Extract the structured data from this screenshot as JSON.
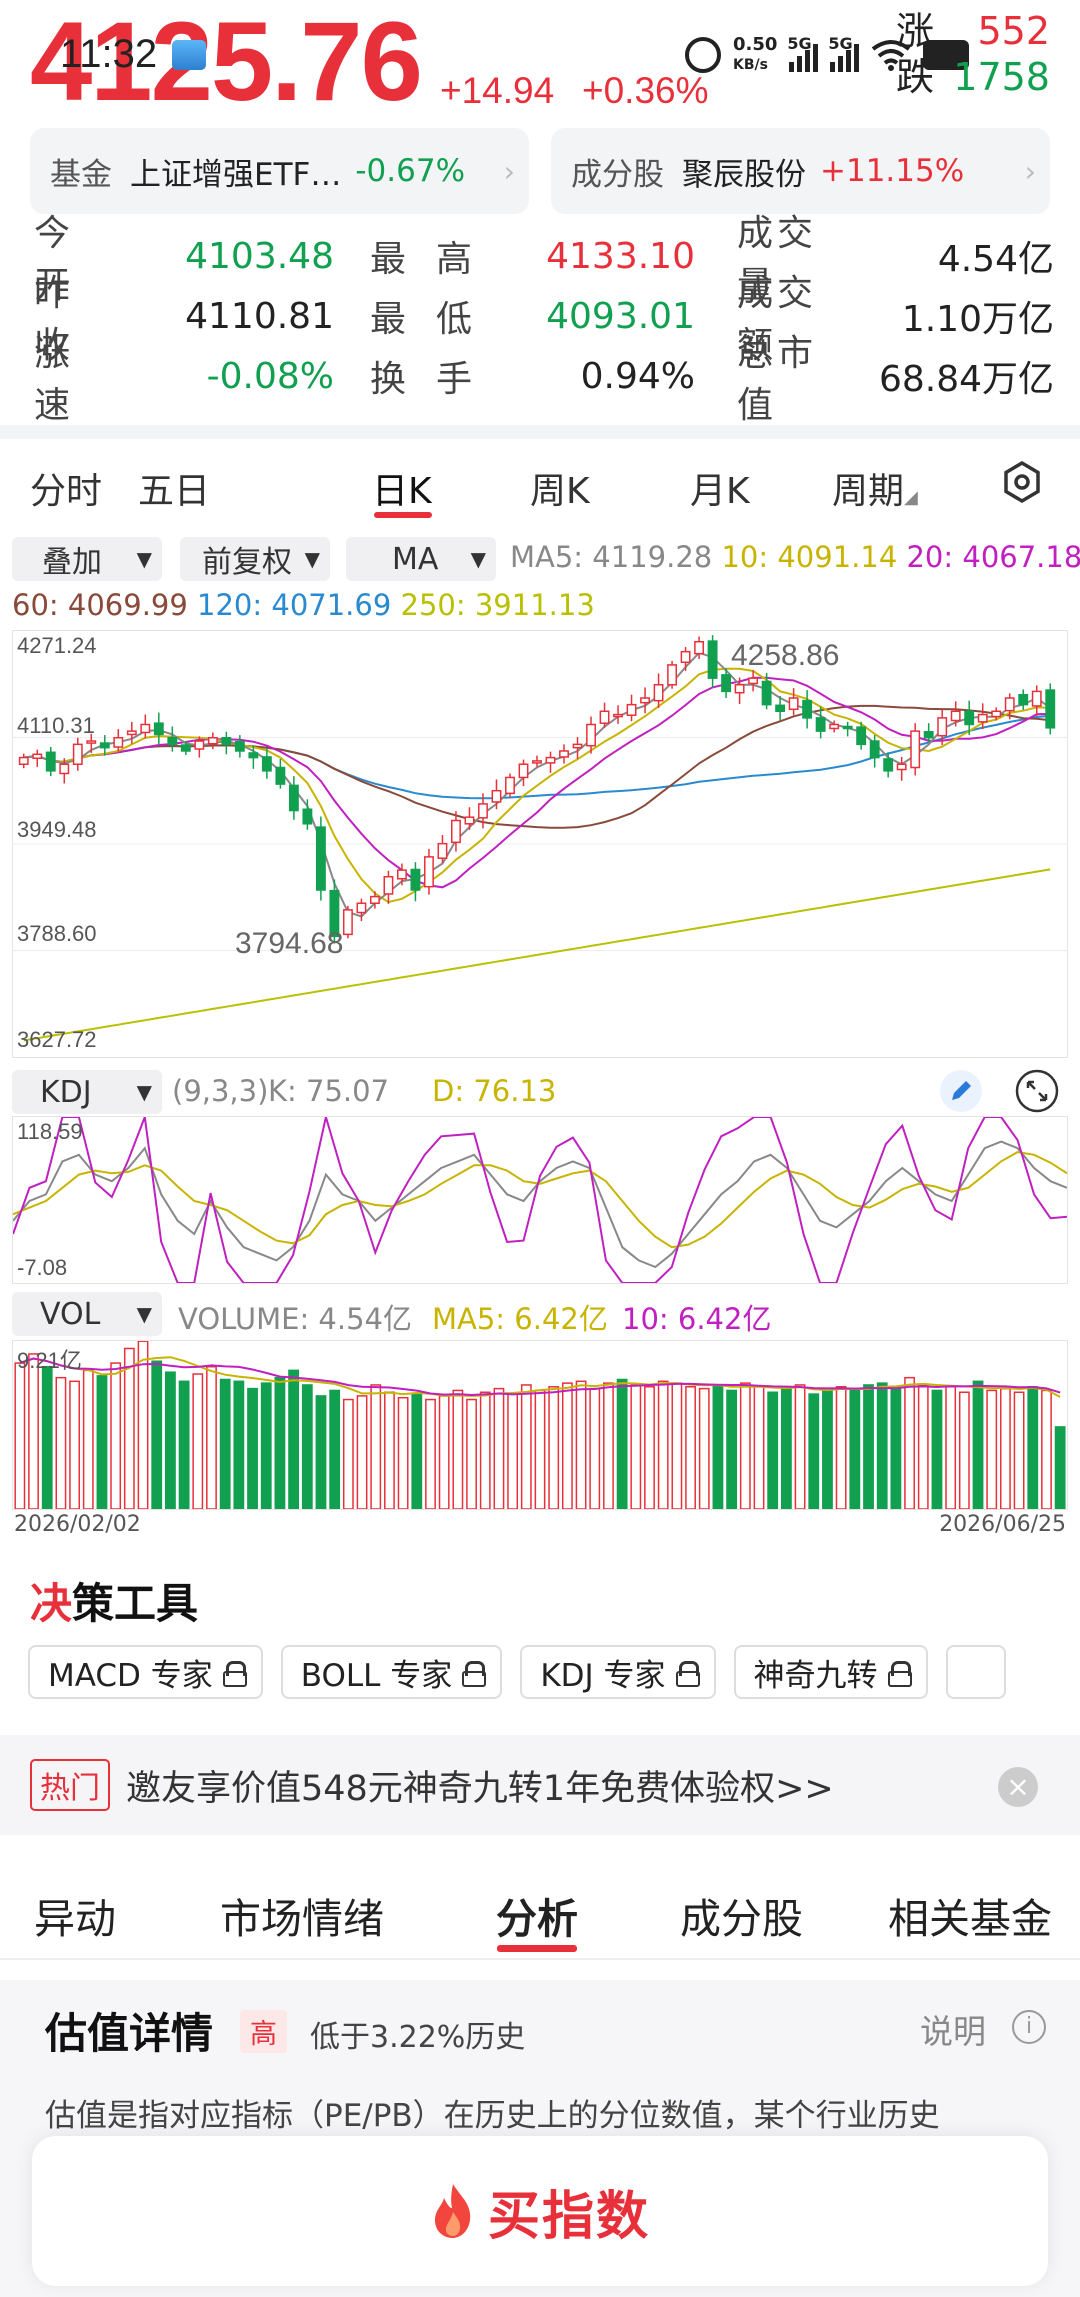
{
  "status_bar": {
    "time": "11:32",
    "net_speed": "0.50",
    "net_unit": "KB/s",
    "sig1": "5G",
    "sig2": "5G"
  },
  "quote": {
    "price": "4125.76",
    "change_abs": "+14.94",
    "change_pct": "+0.36%",
    "up_label": "涨",
    "up_count": "552",
    "down_label": "跌",
    "down_count": "1758"
  },
  "quick": {
    "fund_key": "基金",
    "fund_name": "上证增强ETF…",
    "fund_pct": "-0.67%",
    "comp_key": "成分股",
    "comp_name": "聚辰股份",
    "comp_pct": "+11.15%"
  },
  "stats": [
    [
      {
        "label": "今开",
        "value": "4103.48",
        "color": "green"
      },
      {
        "label": "最高",
        "value": "4133.10",
        "color": "red"
      },
      {
        "label": "成交量",
        "value": "4.54亿",
        "color": "black"
      }
    ],
    [
      {
        "label": "昨收",
        "value": "4110.81",
        "color": "black"
      },
      {
        "label": "最低",
        "value": "4093.01",
        "color": "green"
      },
      {
        "label": "成交额",
        "value": "1.10万亿",
        "color": "black"
      }
    ],
    [
      {
        "label": "涨速",
        "value": "-0.08%",
        "color": "green"
      },
      {
        "label": "换手",
        "value": "0.94%",
        "color": "black"
      },
      {
        "label": "总市值",
        "value": "68.84万亿",
        "color": "black"
      }
    ]
  ],
  "period_tabs": [
    "分时",
    "五日",
    "日K",
    "周K",
    "月K",
    "周期"
  ],
  "selectors": {
    "overlay": "叠加",
    "adjust": "前复权",
    "indicator": "MA"
  },
  "ma": {
    "ma5": "MA5: 4119.28",
    "ma10": "10: 4091.14",
    "ma20": "20: 4067.18",
    "ma60": "60: 4069.99",
    "ma120": "120: 4071.69",
    "ma250": "250: 3911.13",
    "colors": {
      "ma5": "#888888",
      "ma10": "#c8b400",
      "ma20": "#c020c0",
      "ma60": "#8a4a3a",
      "ma120": "#2a8ad0",
      "ma250": "#b8c000"
    }
  },
  "kline_axis": {
    "y1": "4271.24",
    "y2": "4110.31",
    "y3": "3949.48",
    "y4": "3788.60",
    "y5": "3627.72",
    "high_mark": "4258.86",
    "low_mark": "3794.68"
  },
  "kdj": {
    "name": "KDJ",
    "params": "(9,3,3)",
    "k": "K: 75.07",
    "d": "D: 76.13",
    "y_top": "118.59",
    "y_bottom": "-7.08"
  },
  "vol": {
    "name": "VOL",
    "volume": "VOLUME: 4.54亿",
    "ma5": "MA5: 6.42亿",
    "ma10": "10: 6.42亿",
    "y_top": "9.21亿"
  },
  "dates": {
    "start": "2026/02/02",
    "end": "2026/06/25"
  },
  "tools": {
    "title_accent": "决",
    "title_rest": "策工具",
    "items": [
      "MACD 专家",
      "BOLL 专家",
      "KDJ 专家",
      "神奇九转"
    ]
  },
  "promo": {
    "tag": "热门",
    "text": "邀友享价值548元神奇九转1年免费体验权>>"
  },
  "bottom_tabs": [
    "异动",
    "市场情绪",
    "分析",
    "成分股",
    "相关基金"
  ],
  "valuation": {
    "title": "估值详情",
    "badge": "高",
    "low_text": "低于3.22%历史",
    "explain": "说明",
    "desc": "估值是指对应指标（PE/PB）在历史上的分位数值，某个行业历史"
  },
  "buy_button": "买指数",
  "chart_data": [
    {
      "type": "candlestick",
      "title": "",
      "ylim": [
        3627.72,
        4271.24
      ],
      "x_range": [
        "2026/02/02",
        "2026/06/25"
      ],
      "annotations": {
        "high": 4258.86,
        "low": 3794.68
      },
      "close": [
        4080,
        4085,
        4060,
        4070,
        4100,
        4105,
        4095,
        4110,
        4120,
        4130,
        4115,
        4100,
        4090,
        4105,
        4110,
        4100,
        4090,
        4080,
        4060,
        4040,
        4000,
        3980,
        3880,
        3810,
        3850,
        3860,
        3870,
        3900,
        3910,
        3880,
        3930,
        3950,
        3985,
        3990,
        4010,
        4030,
        4050,
        4070,
        4075,
        4080,
        4090,
        4100,
        4130,
        4150,
        4145,
        4160,
        4170,
        4190,
        4220,
        4240,
        4255,
        4200,
        4180,
        4190,
        4200,
        4160,
        4150,
        4170,
        4140,
        4120,
        4130,
        4125,
        4100,
        4080,
        4060,
        4070,
        4120,
        4110,
        4140,
        4150,
        4130,
        4145,
        4150,
        4170,
        4160,
        4180,
        4125
      ],
      "ma": {
        "ma5": 4119.28,
        "ma10": 4091.14,
        "ma20": 4067.18,
        "ma60": 4069.99,
        "ma120": 4071.69,
        "ma250": 3911.13
      }
    },
    {
      "type": "line",
      "title": "KDJ",
      "ylim": [
        -7.08,
        118.59
      ],
      "series": [
        {
          "name": "K",
          "values": [
            40,
            55,
            60,
            85,
            90,
            75,
            70,
            80,
            95,
            60,
            40,
            30,
            55,
            35,
            20,
            15,
            10,
            20,
            40,
            75,
            60,
            55,
            40,
            50,
            60,
            70,
            80,
            85,
            90,
            75,
            60,
            55,
            70,
            80,
            85,
            80,
            50,
            20,
            10,
            5,
            15,
            30,
            45,
            60,
            70,
            85,
            90,
            80,
            60,
            40,
            35,
            45,
            55,
            70,
            80,
            70,
            60,
            55,
            75,
            95,
            100,
            95,
            80,
            70,
            65
          ]
        },
        {
          "name": "D",
          "values": [
            45,
            50,
            55,
            65,
            75,
            78,
            76,
            77,
            82,
            78,
            66,
            55,
            52,
            48,
            40,
            32,
            25,
            23,
            29,
            45,
            52,
            55,
            52,
            51,
            55,
            60,
            68,
            75,
            82,
            82,
            78,
            70,
            68,
            72,
            76,
            78,
            70,
            55,
            40,
            28,
            20,
            22,
            28,
            38,
            50,
            62,
            72,
            78,
            75,
            68,
            58,
            52,
            50,
            56,
            64,
            68,
            66,
            62,
            65,
            75,
            85,
            92,
            90,
            84,
            76
          ]
        }
      ]
    },
    {
      "type": "bar",
      "title": "VOL",
      "ylim": [
        0,
        9.21
      ],
      "values": [
        8.0,
        8.5,
        7.8,
        7.2,
        7.0,
        7.6,
        7.3,
        8.0,
        8.8,
        9.2,
        8.1,
        7.5,
        7.0,
        7.4,
        7.8,
        7.1,
        7.0,
        6.6,
        6.9,
        7.2,
        7.6,
        6.8,
        6.2,
        6.5,
        6.0,
        6.2,
        6.8,
        6.4,
        6.1,
        6.3,
        6.0,
        6.2,
        6.5,
        6.0,
        6.4,
        6.6,
        6.3,
        6.8,
        6.5,
        6.7,
        6.9,
        7.0,
        6.6,
        6.9,
        7.1,
        6.8,
        6.7,
        7.0,
        6.9,
        6.7,
        6.6,
        6.8,
        6.5,
        6.9,
        6.7,
        6.4,
        6.6,
        6.8,
        6.3,
        6.5,
        6.7,
        6.6,
        6.8,
        6.9,
        6.6,
        7.2,
        6.8,
        6.5,
        6.7,
        6.4,
        7.0,
        6.5,
        6.6,
        6.4,
        6.7,
        6.5,
        4.5
      ]
    }
  ]
}
